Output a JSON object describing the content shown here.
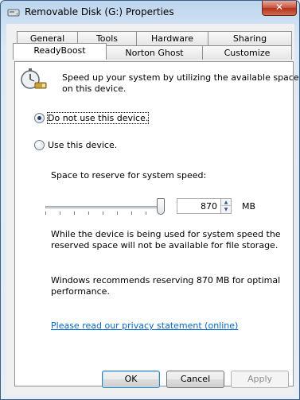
{
  "window": {
    "title": "Removable Disk (G:) Properties",
    "close_symbol": "✕",
    "accent": "#3b5f82"
  },
  "tabs_row1": [
    {
      "label": "General"
    },
    {
      "label": "Tools"
    },
    {
      "label": "Hardware"
    },
    {
      "label": "Sharing"
    }
  ],
  "tabs_row2": [
    {
      "label": "ReadyBoost",
      "active": true
    },
    {
      "label": "Norton Ghost"
    },
    {
      "label": "Customize"
    }
  ],
  "readyboost": {
    "icon": "readyboost-stopwatch-icon",
    "intro_line1": "Speed up your system by utilizing the available space",
    "intro_line2": "on this device.",
    "option_no": "Do not use this device.",
    "option_yes": "Use this device.",
    "selected_option": "Do not use this device.",
    "reserve_label": "Space to reserve for system speed:",
    "slider_level_fraction": 1.0,
    "reserve_value": "870",
    "reserve_unit": "MB",
    "note_line1": "While the device is being used for system speed the",
    "note_line2": "reserved space will not be available for file storage.",
    "recommend_line1": "Windows recommends reserving 870 MB for optimal",
    "recommend_line2": "performance.",
    "privacy_link": "Please read our privacy statement (online)"
  },
  "buttons": {
    "ok": "OK",
    "cancel": "Cancel",
    "apply": "Apply"
  }
}
